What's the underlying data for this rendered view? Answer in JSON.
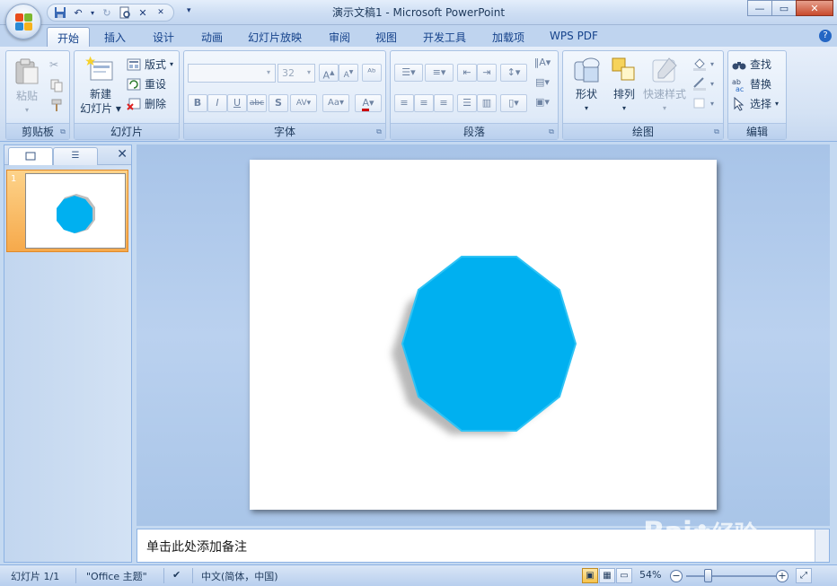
{
  "window": {
    "title": "演示文稿1 - Microsoft PowerPoint"
  },
  "ribbon_tabs": [
    "开始",
    "插入",
    "设计",
    "动画",
    "幻灯片放映",
    "审阅",
    "视图",
    "开发工具",
    "加载项",
    "WPS PDF"
  ],
  "groups": {
    "clipboard": {
      "label": "剪贴板",
      "paste": "粘贴"
    },
    "slides": {
      "label": "幻灯片",
      "new_slide_line1": "新建",
      "new_slide_line2": "幻灯片",
      "layout": "版式",
      "reset": "重设",
      "delete": "删除"
    },
    "font": {
      "label": "字体",
      "font_name": "",
      "font_size": "32"
    },
    "paragraph": {
      "label": "段落"
    },
    "drawing": {
      "label": "绘图",
      "shapes": "形状",
      "arrange": "排列",
      "quick_styles": "快速样式"
    },
    "editing": {
      "label": "编辑",
      "find": "查找",
      "replace": "替换",
      "select": "选择"
    }
  },
  "slide_pane": {
    "slide_number": "1"
  },
  "notes": {
    "placeholder": "单击此处添加备注"
  },
  "status": {
    "slide": "幻灯片 1/1",
    "theme": "\"Office 主题\"",
    "language": "中文(简体，中国)",
    "zoom": "54%"
  },
  "shape": {
    "type": "decagon",
    "fill": "#00b0f0"
  },
  "watermark": {
    "text": "Bai",
    "text2": "经验"
  }
}
